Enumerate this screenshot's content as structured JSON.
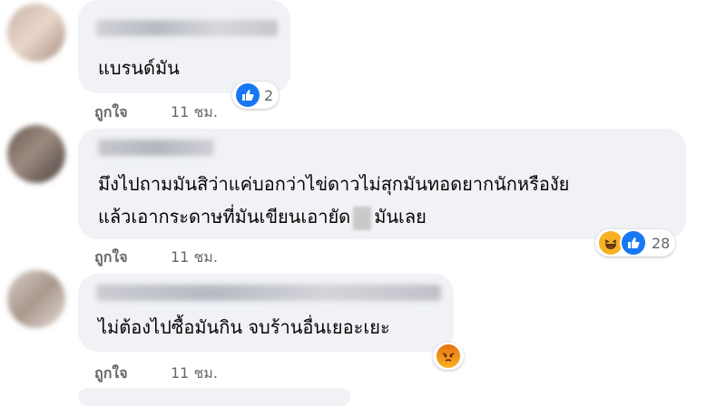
{
  "comments": [
    {
      "text_lines": [
        "แบรนด์มัน"
      ],
      "like_label": "ถูกใจ",
      "time": "11 ชม.",
      "reaction_count": "2",
      "reactions": [
        "like-icon"
      ]
    },
    {
      "text_lines": [
        "มึงไปถามมันสิว่าแค่บอกว่าไข่ดาวไม่สุกมันทอดยากนักหรืองัย",
        "แล้วเอากระดาษที่มันเขียนเอายัด",
        "มันเลย"
      ],
      "like_label": "ถูกใจ",
      "time": "11 ชม.",
      "reaction_count": "28",
      "reactions": [
        "haha-icon",
        "like-icon"
      ]
    },
    {
      "text_lines": [
        "ไม่ต้องไปซื้อมันกิน จบร้านอื่นเยอะเยะ"
      ],
      "like_label": "ถูกใจ",
      "time": "11 ชม.",
      "reaction_count": "",
      "reactions": [
        "angry-icon"
      ]
    }
  ],
  "colors": {
    "bubble": "#f0f2f5",
    "meta_text": "#65676b",
    "like_blue": "#1877f2"
  }
}
